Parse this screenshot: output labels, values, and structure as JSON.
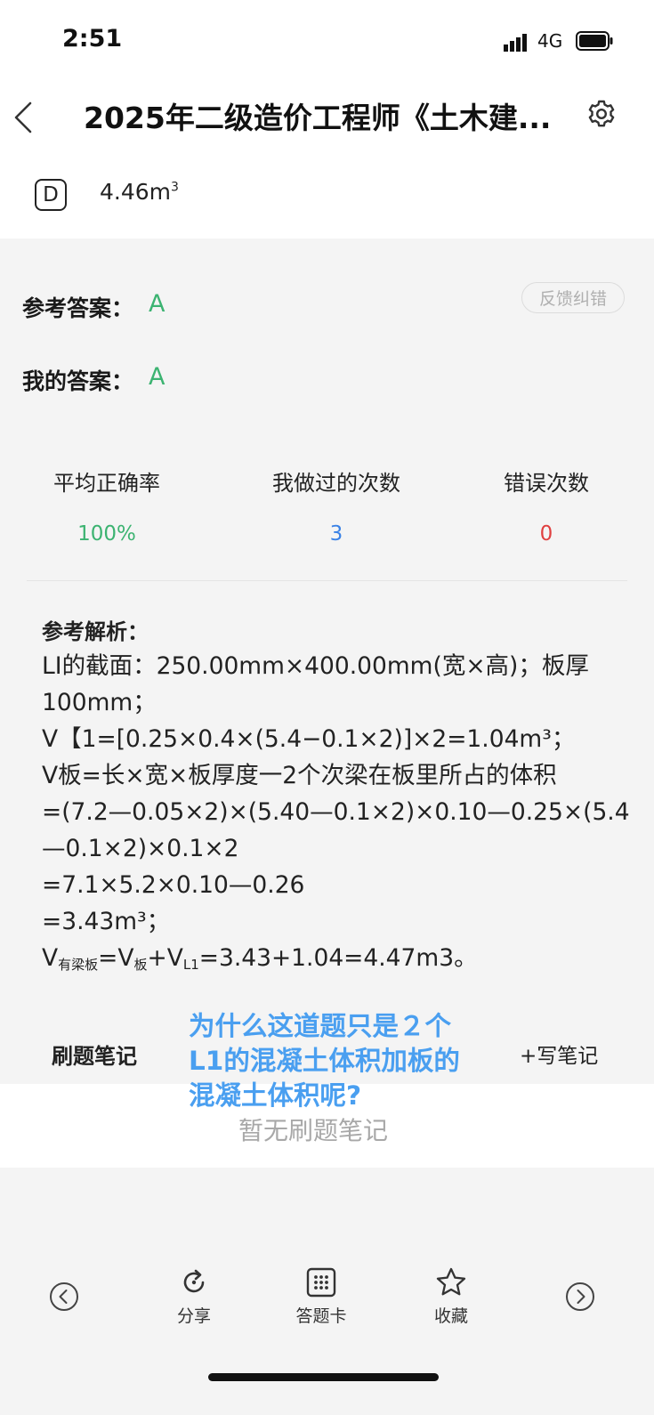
{
  "status_bar": {
    "time": "2:51",
    "network": "4G"
  },
  "nav": {
    "title": "2025年二级造价工程师《土木建..."
  },
  "option": {
    "letter": "D",
    "text": "4.46m",
    "sup": "3"
  },
  "answers": {
    "reference_label": "参考答案：",
    "reference_value": "A",
    "mine_label": "我的答案：",
    "mine_value": "A",
    "feedback_button": "反馈纠错"
  },
  "stats": [
    {
      "label": "平均正确率",
      "value": "100%",
      "color": "#3cb371"
    },
    {
      "label": "我做过的次数",
      "value": "3",
      "color": "#3a82e6"
    },
    {
      "label": "错误次数",
      "value": "0",
      "color": "#e04040"
    }
  ],
  "analysis": {
    "title": "参考解析：",
    "line1": "LI的截面：250.00mm×400.00mm(宽×高)；板厚",
    "line2": "100mm；",
    "line3": "V【1=[0.25×0.4×(5.4−0.1×2)]×2=1.04m³；",
    "line4": "V板=长×宽×板厚度一2个次梁在板里所占的体积",
    "line5": "=(7.2—0.05×2)×(5.40—0.1×2)×0.10—0.25×(5.4",
    "line6": "—0.1×2)×0.1×2",
    "line7": "=7.1×5.2×0.10—0.26",
    "line8": "=3.43m³；",
    "line9_v": "V",
    "line9_sub1": "有梁板",
    "line9_mid": "=V",
    "line9_sub2": "板",
    "line9_mid2": "+V",
    "line9_sub3": "L1",
    "line9_end": "=3.43+1.04=4.47m3。"
  },
  "notes": {
    "header": "刷题笔记",
    "write_button": "+写笔记",
    "empty_text": "暂无刷题笔记",
    "overlay_text_1": "为什么这道题只是２个",
    "overlay_text_2": "L1的混凝土体积加板的",
    "overlay_text_3": "混凝土体积呢?"
  },
  "toolbar": {
    "share_label": "分享",
    "answer_card_label": "答题卡",
    "favorite_label": "收藏"
  }
}
